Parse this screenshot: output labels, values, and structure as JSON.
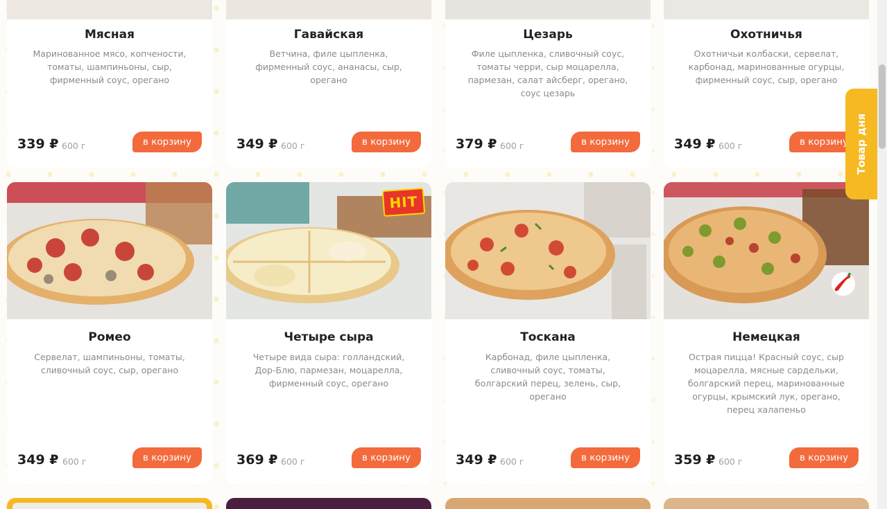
{
  "products": [
    {
      "name": "Мясная",
      "desc": "Маринованное мясо, копчености, томаты, шампиньоны, сыр, фирменный соус, орегано",
      "price": "339 ₽",
      "weight": "600 г",
      "button": "в корзину"
    },
    {
      "name": "Гавайская",
      "desc": "Ветчина, филе цыпленка, фирменный соус, ананасы, сыр, орегано",
      "price": "349 ₽",
      "weight": "600 г",
      "button": "в корзину"
    },
    {
      "name": "Цезарь",
      "desc": "Филе цыпленка, сливочный соус, томаты черри, сыр моцарелла, пармезан, салат айсберг, орегано, соус цезарь",
      "price": "379 ₽",
      "weight": "600 г",
      "button": "в корзину"
    },
    {
      "name": "Охотничья",
      "desc": "Охотничьи колбаски, сервелат, карбонад, маринованные огурцы, фирменный соус, сыр, орегано",
      "price": "349 ₽",
      "weight": "600 г",
      "button": "в корзину"
    },
    {
      "name": "Ромео",
      "desc": "Сервелат, шампиньоны, томаты, сливочный соус, сыр, орегано",
      "price": "349 ₽",
      "weight": "600 г",
      "button": "в корзину"
    },
    {
      "name": "Четыре сыра",
      "desc": "Четыре вида сыра: голландский, Дор-Блю, пармезан, моцарелла, фирменный соус, орегано",
      "price": "369 ₽",
      "weight": "600 г",
      "button": "в корзину",
      "badge": "HIT"
    },
    {
      "name": "Тоскана",
      "desc": "Карбонад, филе цыпленка, сливочный соус, томаты, болгарский перец, зелень, сыр, орегано",
      "price": "349 ₽",
      "weight": "600 г",
      "button": "в корзину"
    },
    {
      "name": "Немецкая",
      "desc": "Острая пицца! Красный соус, сыр моцарелла, мясные сардельки, болгарский перец, маринованные огурцы, крымский лук, орегано, перец халапеньо",
      "price": "359 ₽",
      "weight": "600 г",
      "button": "в корзину",
      "icon": "chili-pepper-icon"
    }
  ],
  "side_tab": {
    "label": "Товар дня"
  },
  "colors": {
    "accent": "#f36a3c",
    "tab": "#f6b922",
    "background": "#fdfcf8"
  }
}
